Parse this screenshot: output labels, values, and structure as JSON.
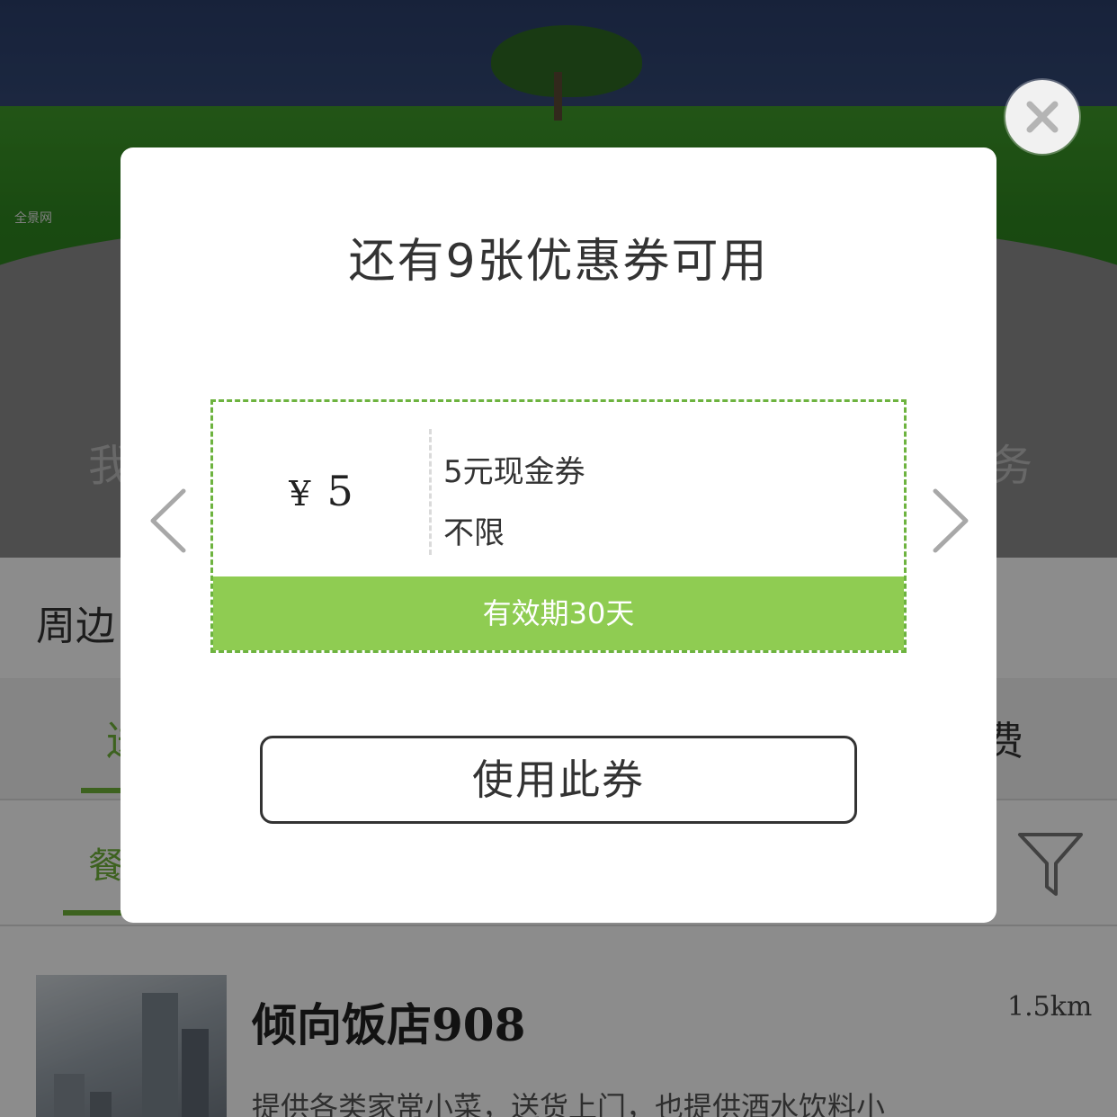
{
  "background": {
    "hero_watermark": "全景网",
    "hero_text_left": "我",
    "hero_text_right": "务",
    "section_title": "周边",
    "tab_left": "送",
    "tab_right": "费",
    "filter_left": "餐",
    "shop": {
      "name": "倾向饭店908",
      "distance": "1.5km",
      "description": "提供各类家常小菜，送货上门，也提供酒水饮料小"
    }
  },
  "modal": {
    "title": "还有9张优惠券可用",
    "coupon": {
      "currency_symbol": "¥",
      "amount": "5",
      "name": "5元现金券",
      "scope": "不限",
      "validity": "有效期30天"
    },
    "use_button": "使用此券"
  },
  "icons": {
    "close": "close-icon",
    "prev": "chevron-left-icon",
    "next": "chevron-right-icon",
    "filter": "filter-icon"
  },
  "colors": {
    "accent_green": "#6db33f",
    "validity_bg": "#8fcc52",
    "overlay": "rgba(0,0,0,0.45)"
  }
}
